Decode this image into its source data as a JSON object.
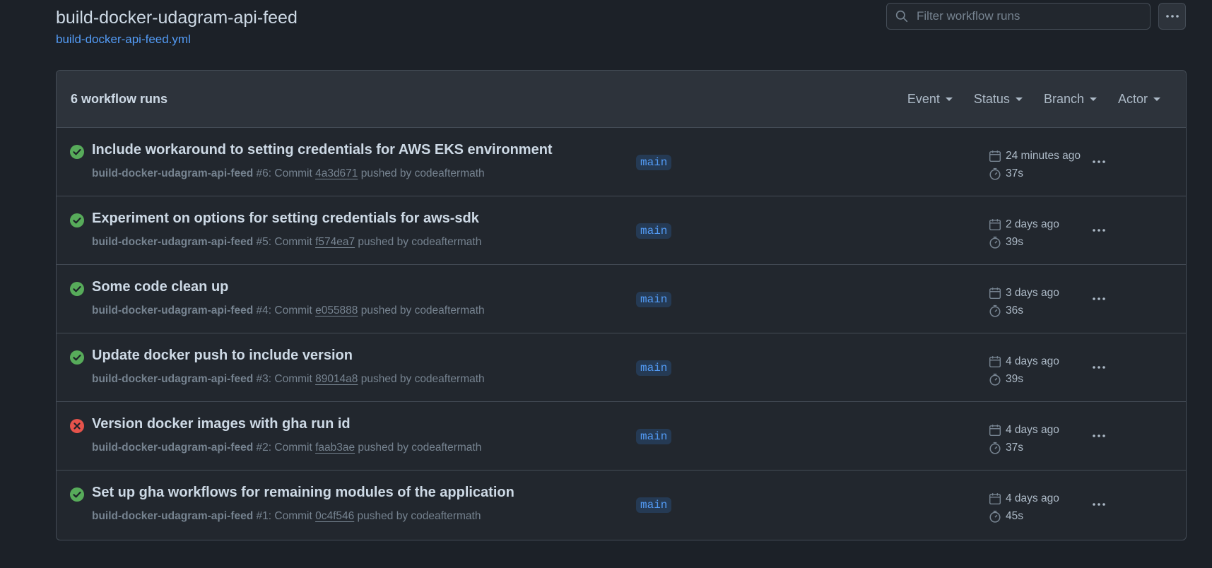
{
  "header": {
    "workflow_title": "build-docker-udagram-api-feed",
    "workflow_file": "build-docker-api-feed.yml"
  },
  "search": {
    "placeholder": "Filter workflow runs"
  },
  "list": {
    "count_label": "6 workflow runs",
    "filters": [
      {
        "label": "Event"
      },
      {
        "label": "Status"
      },
      {
        "label": "Branch"
      },
      {
        "label": "Actor"
      }
    ]
  },
  "colors": {
    "success": "#57ab5a",
    "failure": "#e5534b",
    "accent": "#539bf5"
  },
  "runs": [
    {
      "title": "Include workaround to setting credentials for AWS EKS environment",
      "status": "success",
      "workflow_name": "build-docker-udagram-api-feed",
      "run_label": " #6: Commit ",
      "sha": "4a3d671",
      "pushed_by": " pushed by codeaftermath",
      "branch": "main",
      "when": "24 minutes ago",
      "duration": "37s"
    },
    {
      "title": "Experiment on options for setting credentials for aws-sdk",
      "status": "success",
      "workflow_name": "build-docker-udagram-api-feed",
      "run_label": " #5: Commit ",
      "sha": "f574ea7",
      "pushed_by": " pushed by codeaftermath",
      "branch": "main",
      "when": "2 days ago",
      "duration": "39s"
    },
    {
      "title": "Some code clean up",
      "status": "success",
      "workflow_name": "build-docker-udagram-api-feed",
      "run_label": " #4: Commit ",
      "sha": "e055888",
      "pushed_by": " pushed by codeaftermath",
      "branch": "main",
      "when": "3 days ago",
      "duration": "36s"
    },
    {
      "title": "Update docker push to include version",
      "status": "success",
      "workflow_name": "build-docker-udagram-api-feed",
      "run_label": " #3: Commit ",
      "sha": "89014a8",
      "pushed_by": " pushed by codeaftermath",
      "branch": "main",
      "when": "4 days ago",
      "duration": "39s"
    },
    {
      "title": "Version docker images with gha run id",
      "status": "failure",
      "workflow_name": "build-docker-udagram-api-feed",
      "run_label": " #2: Commit ",
      "sha": "faab3ae",
      "pushed_by": " pushed by codeaftermath",
      "branch": "main",
      "when": "4 days ago",
      "duration": "37s"
    },
    {
      "title": "Set up gha workflows for remaining modules of the application",
      "status": "success",
      "workflow_name": "build-docker-udagram-api-feed",
      "run_label": " #1: Commit ",
      "sha": "0c4f546",
      "pushed_by": " pushed by codeaftermath",
      "branch": "main",
      "when": "4 days ago",
      "duration": "45s"
    }
  ]
}
